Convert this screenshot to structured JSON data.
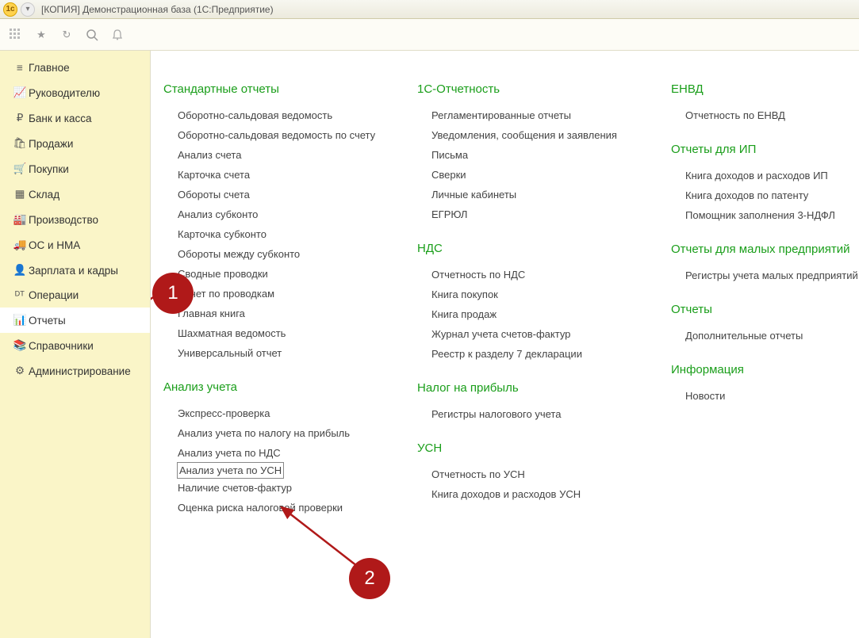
{
  "window": {
    "title": "[КОПИЯ] Демонстрационная база  (1С:Предприятие)"
  },
  "sidebar": {
    "items": [
      {
        "id": "main",
        "label": "Главное",
        "icon_name": "menu-icon",
        "glyph": "≡"
      },
      {
        "id": "manager",
        "label": "Руководителю",
        "icon_name": "chart-up-icon",
        "glyph": "📈"
      },
      {
        "id": "bank",
        "label": "Банк и касса",
        "icon_name": "ruble-icon",
        "glyph": "₽"
      },
      {
        "id": "sales",
        "label": "Продажи",
        "icon_name": "bag-icon",
        "glyph": "🛍"
      },
      {
        "id": "purch",
        "label": "Покупки",
        "icon_name": "cart-icon",
        "glyph": "🛒"
      },
      {
        "id": "stock",
        "label": "Склад",
        "icon_name": "boxes-icon",
        "glyph": "▦"
      },
      {
        "id": "prod",
        "label": "Производство",
        "icon_name": "factory-icon",
        "glyph": "🏭"
      },
      {
        "id": "assets",
        "label": "ОС и НМА",
        "icon_name": "truck-icon",
        "glyph": "🚚"
      },
      {
        "id": "hr",
        "label": "Зарплата и кадры",
        "icon_name": "person-icon",
        "glyph": "👤"
      },
      {
        "id": "ops",
        "label": "Операции",
        "icon_name": "dt-kt-icon",
        "glyph": "ᴰᵀ"
      },
      {
        "id": "reports",
        "label": "Отчеты",
        "icon_name": "bar-chart-icon",
        "glyph": "📊"
      },
      {
        "id": "refs",
        "label": "Справочники",
        "icon_name": "books-icon",
        "glyph": "📚"
      },
      {
        "id": "admin",
        "label": "Администрирование",
        "icon_name": "gear-icon",
        "glyph": "⚙"
      }
    ],
    "active_id": "reports"
  },
  "content": {
    "columns": [
      {
        "sections": [
          {
            "title": "Стандартные отчеты",
            "links": [
              "Оборотно-сальдовая ведомость",
              "Оборотно-сальдовая ведомость по счету",
              "Анализ счета",
              "Карточка счета",
              "Обороты счета",
              "Анализ субконто",
              "Карточка субконто",
              "Обороты между субконто",
              "Сводные проводки",
              "Отчет по проводкам",
              "Главная книга",
              "Шахматная ведомость",
              "Универсальный отчет"
            ]
          },
          {
            "title": "Анализ учета",
            "links": [
              "Экспресс-проверка",
              "Анализ учета по налогу на прибыль",
              "Анализ учета по НДС",
              "Анализ учета по УСН",
              "Наличие счетов-фактур",
              "Оценка риска налоговой проверки"
            ],
            "boxed_index": 3
          }
        ]
      },
      {
        "sections": [
          {
            "title": "1С-Отчетность",
            "links": [
              "Регламентированные отчеты",
              "Уведомления, сообщения и заявления",
              "Письма",
              "Сверки",
              "Личные кабинеты",
              "ЕГРЮЛ"
            ]
          },
          {
            "title": "НДС",
            "links": [
              "Отчетность по НДС",
              "Книга покупок",
              "Книга продаж",
              "Журнал учета счетов-фактур",
              "Реестр к разделу 7 декларации"
            ]
          },
          {
            "title": "Налог на прибыль",
            "links": [
              "Регистры налогового учета"
            ]
          },
          {
            "title": "УСН",
            "links": [
              "Отчетность по УСН",
              "Книга доходов и расходов УСН"
            ]
          }
        ]
      },
      {
        "sections": [
          {
            "title": "ЕНВД",
            "links": [
              "Отчетность по ЕНВД"
            ]
          },
          {
            "title": "Отчеты для ИП",
            "links": [
              "Книга доходов и расходов ИП",
              "Книга доходов по патенту",
              "Помощник заполнения 3-НДФЛ"
            ]
          },
          {
            "title": "Отчеты для малых предприятий",
            "links": [
              "Регистры учета малых предприятий"
            ]
          },
          {
            "title": "Отчеты",
            "links": [
              "Дополнительные отчеты"
            ]
          },
          {
            "title": "Информация",
            "links": [
              "Новости"
            ]
          }
        ]
      }
    ]
  },
  "annotations": {
    "marker1": "1",
    "marker2": "2"
  }
}
